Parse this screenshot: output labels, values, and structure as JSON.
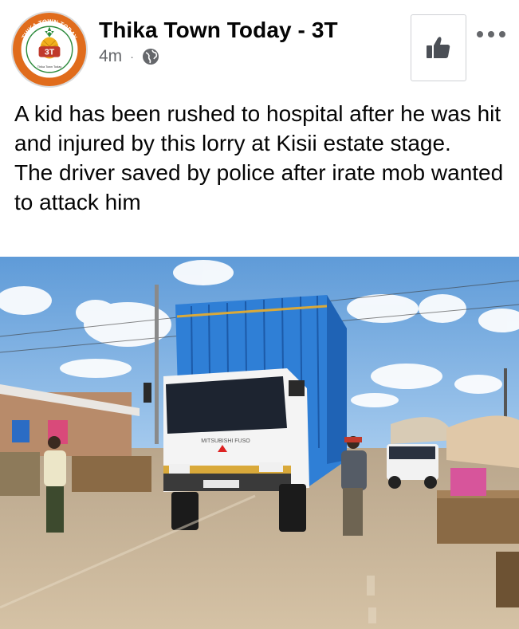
{
  "post": {
    "page_name": "Thika Town Today - 3T",
    "time_ago": "4m",
    "separator": "·",
    "privacy_icon": "globe-icon",
    "like_icon": "thumbs-up-icon",
    "more_icon": "more-options-icon",
    "text_paragraphs": [
      "A kid has been rushed to hospital after he was hit and injured by this lorry at Kisii estate stage.",
      "The driver saved by police after irate mob wanted to attack him"
    ]
  },
  "avatar": {
    "ring_text_top": "THIKA TOWN TODAY",
    "ring_text_bottom": "Telling the Thika Story As It Is",
    "badge": "3T",
    "caption": "Thika Town Today"
  },
  "photo": {
    "truck_brand": "MITSUBISHI FUSO",
    "colors": {
      "sky": "#6fa6dc",
      "truck_body": "#2f7fd6",
      "road": "#c9b59a"
    }
  }
}
